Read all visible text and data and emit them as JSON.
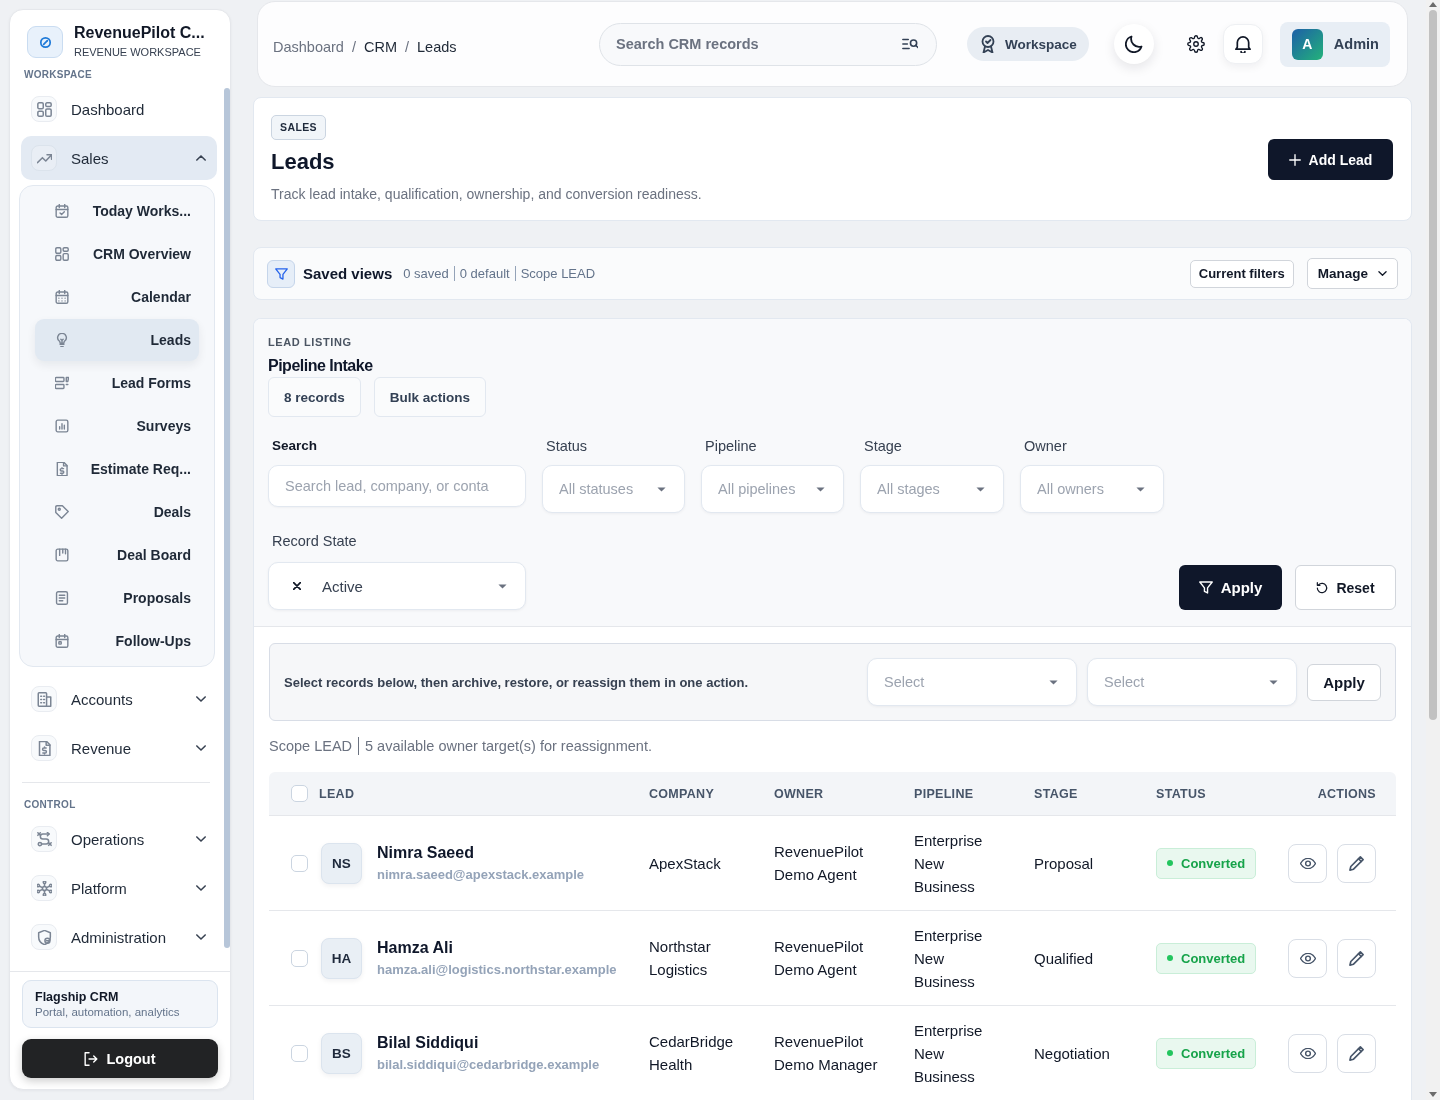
{
  "sidebar": {
    "brand": {
      "title": "RevenuePilot C...",
      "subtitle": "REVENUE WORKSPACE"
    },
    "sections": [
      {
        "label": "WORKSPACE",
        "items": [
          {
            "label": "Dashboard",
            "kind": "link",
            "selected": false
          },
          {
            "label": "Sales",
            "kind": "group",
            "selected": true,
            "expanded": true,
            "children": [
              {
                "label": "Today Works...",
                "selected": false
              },
              {
                "label": "CRM Overview",
                "selected": false
              },
              {
                "label": "Calendar",
                "selected": false
              },
              {
                "label": "Leads",
                "selected": true
              },
              {
                "label": "Lead Forms",
                "selected": false
              },
              {
                "label": "Surveys",
                "selected": false
              },
              {
                "label": "Estimate Req...",
                "selected": false
              },
              {
                "label": "Deals",
                "selected": false
              },
              {
                "label": "Deal Board",
                "selected": false
              },
              {
                "label": "Proposals",
                "selected": false
              },
              {
                "label": "Follow-Ups",
                "selected": false
              }
            ]
          },
          {
            "label": "Accounts",
            "kind": "group",
            "selected": false,
            "expanded": false
          },
          {
            "label": "Revenue",
            "kind": "group",
            "selected": false,
            "expanded": false
          }
        ]
      },
      {
        "label": "CONTROL",
        "items": [
          {
            "label": "Operations",
            "kind": "group",
            "selected": false,
            "expanded": false
          },
          {
            "label": "Platform",
            "kind": "group",
            "selected": false,
            "expanded": false
          },
          {
            "label": "Administration",
            "kind": "group",
            "selected": false,
            "expanded": false
          }
        ]
      }
    ],
    "plan": {
      "title": "Flagship CRM",
      "subtitle": "Portal, automation, analytics"
    },
    "logout_button": "Logout"
  },
  "topbar": {
    "breadcrumbs": [
      {
        "label": "Dashboard",
        "kind": "link"
      },
      {
        "label": "/",
        "kind": "separator"
      },
      {
        "label": "CRM",
        "kind": "text"
      },
      {
        "label": "/",
        "kind": "separator"
      },
      {
        "label": "Leads",
        "kind": "text"
      }
    ],
    "search": {
      "placeholder": "Search CRM records"
    },
    "workspace_button": "Workspace",
    "account": {
      "initial": "A",
      "name": "Admin"
    }
  },
  "page_header": {
    "badge": "SALES",
    "title": "Leads",
    "description": "Track lead intake, qualification, ownership, and conversion readiness.",
    "add_button": "Add Lead"
  },
  "saved_views": {
    "title": "Saved views",
    "stats": [
      "0 saved",
      "0 default",
      "Scope LEAD"
    ],
    "current_filters_button": "Current filters",
    "manage_button": "Manage"
  },
  "lead_listing": {
    "eyebrow": "LEAD LISTING",
    "title": "Pipeline Intake",
    "chips": [
      "8 records",
      "Bulk actions"
    ],
    "filters": [
      {
        "label": "Search",
        "kind": "text",
        "placeholder": "Search lead, company, or conta"
      },
      {
        "label": "Status",
        "kind": "select",
        "placeholder": "All statuses"
      },
      {
        "label": "Pipeline",
        "kind": "select",
        "placeholder": "All pipelines"
      },
      {
        "label": "Stage",
        "kind": "select",
        "placeholder": "All stages"
      },
      {
        "label": "Owner",
        "kind": "select",
        "placeholder": "All owners"
      }
    ],
    "record_state": {
      "label": "Record State",
      "value": "Active"
    },
    "apply_button": "Apply",
    "reset_button": "Reset",
    "bulk_actions": {
      "text": "Select records below, then archive, restore, or reassign them in one action.",
      "selects": [
        {
          "placeholder": "Select"
        },
        {
          "placeholder": "Select"
        }
      ],
      "apply_button": "Apply"
    },
    "scope_note": [
      "Scope LEAD",
      "5 available owner target(s) for reassignment."
    ],
    "table": {
      "select_all": {
        "checked": false
      },
      "columns": [
        "LEAD",
        "COMPANY",
        "OWNER",
        "PIPELINE",
        "STAGE",
        "STATUS",
        "ACTIONS"
      ],
      "rows": [
        {
          "checked": false,
          "initials": "NS",
          "name": "Nimra Saeed",
          "email": "nimra.saeed@apexstack.example",
          "company": "ApexStack",
          "owner": "RevenuePilot Demo Agent",
          "pipeline": "Enterprise New Business",
          "stage": "Proposal",
          "status": "Converted"
        },
        {
          "checked": false,
          "initials": "HA",
          "name": "Hamza Ali",
          "email": "hamza.ali@logistics.northstar.example",
          "company": "Northstar Logistics",
          "owner": "RevenuePilot Demo Agent",
          "pipeline": "Enterprise New Business",
          "stage": "Qualified",
          "status": "Converted"
        },
        {
          "checked": false,
          "initials": "BS",
          "name": "Bilal Siddiqui",
          "email": "bilal.siddiqui@cedarbridge.example",
          "company": "CedarBridge Health",
          "owner": "RevenuePilot Demo Manager",
          "pipeline": "Enterprise New Business",
          "stage": "Negotiation",
          "status": "Converted"
        }
      ]
    }
  }
}
